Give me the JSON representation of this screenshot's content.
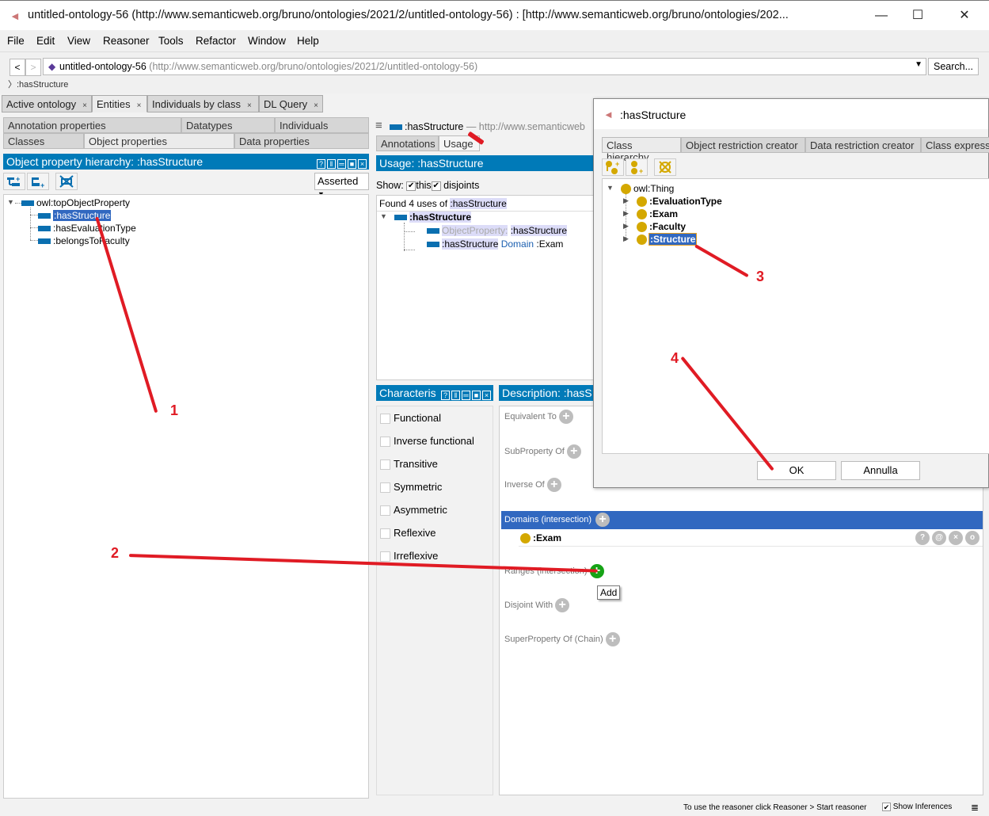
{
  "window": {
    "title": "untitled-ontology-56 (http://www.semanticweb.org/bruno/ontologies/2021/2/untitled-ontology-56)  : [http://www.semanticweb.org/bruno/ontologies/202...",
    "minimize": "—",
    "maximize": "☐",
    "close": "✕"
  },
  "menu": [
    "File",
    "Edit",
    "View",
    "Reasoner",
    "Tools",
    "Refactor",
    "Window",
    "Help"
  ],
  "nav": {
    "back": "<",
    "forward": ">",
    "ontology_name": "untitled-ontology-56",
    "ontology_iri": "(http://www.semanticweb.org/bruno/ontologies/2021/2/untitled-ontology-56)",
    "search_label": "Search...",
    "breadcrumb": ":hasStructure"
  },
  "main_tabs": [
    {
      "label": "Active ontology",
      "close": "×"
    },
    {
      "label": "Entities",
      "close": "×"
    },
    {
      "label": "Individuals by class",
      "close": "×"
    },
    {
      "label": "DL Query",
      "close": "×"
    }
  ],
  "entity_tabs": {
    "row1": [
      "Annotation properties",
      "Datatypes",
      "Individuals"
    ],
    "row2": [
      "Classes",
      "Object properties",
      "Data properties"
    ]
  },
  "hierarchy": {
    "title": "Object property hierarchy: :hasStructure",
    "mode": "Asserted",
    "root": "owl:topObjectProperty",
    "children": [
      ":hasStructure",
      ":hasEvaluationType",
      ":belongsToFaculty"
    ]
  },
  "entity_header": {
    "name": ":hasStructure",
    "iri": "— http://www.semanticweb",
    "tabs": [
      "Annotations",
      "Usage"
    ]
  },
  "usage": {
    "title": "Usage: :hasStructure",
    "show_label": "Show:",
    "this_label": "this",
    "disjoints_label": "disjoints",
    "found_prefix": "Found 4 uses of",
    "found_entity": ":hasStructure",
    "tree_root": ":hasStructure",
    "row1_kw": "ObjectProperty:",
    "row1_val": ":hasStructure",
    "row2_subj": ":hasStructure",
    "row2_kw": "Domain",
    "row2_obj": ":Exam"
  },
  "characteristics": {
    "title": "Characteris",
    "items": [
      "Functional",
      "Inverse functional",
      "Transitive",
      "Symmetric",
      "Asymmetric",
      "Reflexive",
      "Irreflexive"
    ]
  },
  "description": {
    "title": "Description: :hasS",
    "sections": {
      "equivalent": "Equivalent To",
      "subproperty": "SubProperty Of",
      "inverse": "Inverse Of",
      "domains": "Domains (intersection)",
      "ranges": "Ranges (intersection)",
      "disjoint": "Disjoint With",
      "superchain": "SuperProperty Of (Chain)"
    },
    "domain_value": ":Exam",
    "tooltip": "Add"
  },
  "dialog": {
    "title": ":hasStructure",
    "tabs": [
      "Class hierarchy",
      "Object restriction creator",
      "Data restriction creator",
      "Class express"
    ],
    "root": "owl:Thing",
    "classes": [
      ":EvaluationType",
      ":Exam",
      ":Faculty",
      ":Structure"
    ],
    "ok": "OK",
    "cancel": "Annulla"
  },
  "status": {
    "reasoner_msg": "To use the reasoner click Reasoner > Start reasoner",
    "show_inferences": "Show Inferences"
  },
  "annotations": [
    "1",
    "2",
    "3",
    "4"
  ],
  "colors": {
    "header_blue": "#007ab8",
    "selection_blue": "#3168c0",
    "annotation_red": "#e01b24",
    "class_gold": "#d4a800",
    "property_blue": "#0a6fb0"
  }
}
